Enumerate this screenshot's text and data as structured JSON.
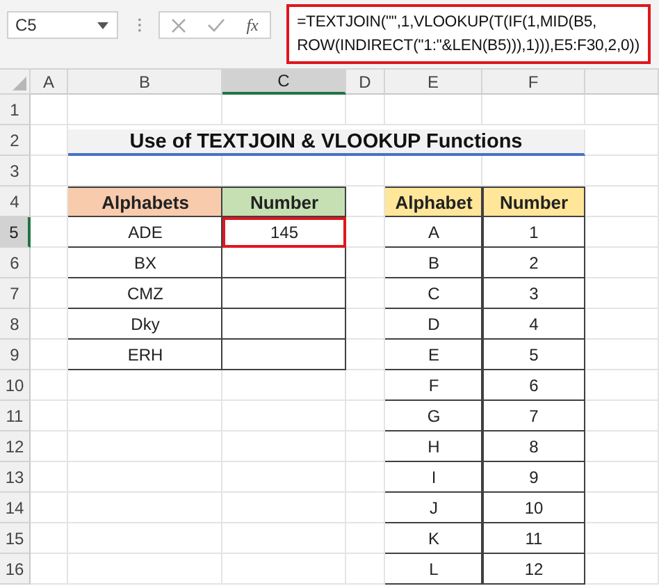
{
  "formula_bar": {
    "name_box": "C5",
    "function_label": "fx",
    "formula_lines": [
      "=TEXTJOIN(\"\",1,VLOOKUP(T(IF(1,MID(B5,",
      "ROW(INDIRECT(\"1:\"&LEN(B5))),1))),E5:F30,2,0))"
    ]
  },
  "columns": [
    {
      "label": "A",
      "selected": false
    },
    {
      "label": "B",
      "selected": false
    },
    {
      "label": "C",
      "selected": true
    },
    {
      "label": "D",
      "selected": false
    },
    {
      "label": "E",
      "selected": false
    },
    {
      "label": "F",
      "selected": false
    }
  ],
  "rows": [
    {
      "label": "1",
      "selected": false
    },
    {
      "label": "2",
      "selected": false
    },
    {
      "label": "3",
      "selected": false
    },
    {
      "label": "4",
      "selected": false
    },
    {
      "label": "5",
      "selected": true
    },
    {
      "label": "6",
      "selected": false
    },
    {
      "label": "7",
      "selected": false
    },
    {
      "label": "8",
      "selected": false
    },
    {
      "label": "9",
      "selected": false
    },
    {
      "label": "10",
      "selected": false
    },
    {
      "label": "11",
      "selected": false
    },
    {
      "label": "12",
      "selected": false
    },
    {
      "label": "13",
      "selected": false
    },
    {
      "label": "14",
      "selected": false
    },
    {
      "label": "15",
      "selected": false
    },
    {
      "label": "16",
      "selected": false
    }
  ],
  "title": "Use of TEXTJOIN & VLOOKUP Functions",
  "input_table": {
    "headers": [
      {
        "label": "Alphabets",
        "color": "#f8cbad"
      },
      {
        "label": "Number",
        "color": "#c6e0b4"
      }
    ],
    "rows": [
      {
        "alphabets": "ADE",
        "number": "145",
        "selected": true
      },
      {
        "alphabets": "BX",
        "selected": false
      },
      {
        "alphabets": "CMZ",
        "selected": false
      },
      {
        "alphabets": "Dky",
        "selected": false
      },
      {
        "alphabets": "ERH",
        "selected": false
      }
    ]
  },
  "lookup_table": {
    "headers": [
      {
        "label": "Alphabet",
        "color": "#ffe699"
      },
      {
        "label": "Number",
        "color": "#ffe699"
      }
    ],
    "rows": [
      [
        "A",
        "1"
      ],
      [
        "B",
        "2"
      ],
      [
        "C",
        "3"
      ],
      [
        "D",
        "4"
      ],
      [
        "E",
        "5"
      ],
      [
        "F",
        "6"
      ],
      [
        "G",
        "7"
      ],
      [
        "H",
        "8"
      ],
      [
        "I",
        "9"
      ],
      [
        "J",
        "10"
      ],
      [
        "K",
        "11"
      ],
      [
        "L",
        "12"
      ]
    ]
  }
}
